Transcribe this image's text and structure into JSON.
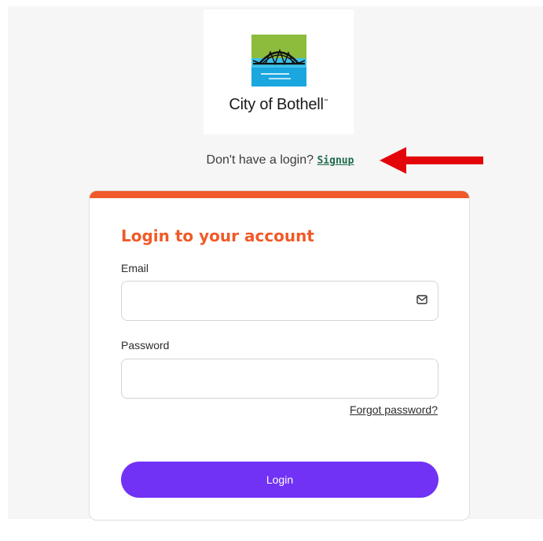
{
  "logo": {
    "text": "City of Bothell",
    "trademark": "™"
  },
  "signup": {
    "prompt": "Don't have a login?",
    "link_label": "Signup"
  },
  "login_card": {
    "title": "Login to your account",
    "email_label": "Email",
    "email_value": "",
    "email_icon": "mail-icon",
    "password_label": "Password",
    "password_value": "",
    "forgot_label": "Forgot password?",
    "login_label": "Login"
  },
  "colors": {
    "accent": "#f05a28",
    "button": "#7132f5",
    "link": "#1f6b4b",
    "annotation_arrow": "#e3050a"
  }
}
